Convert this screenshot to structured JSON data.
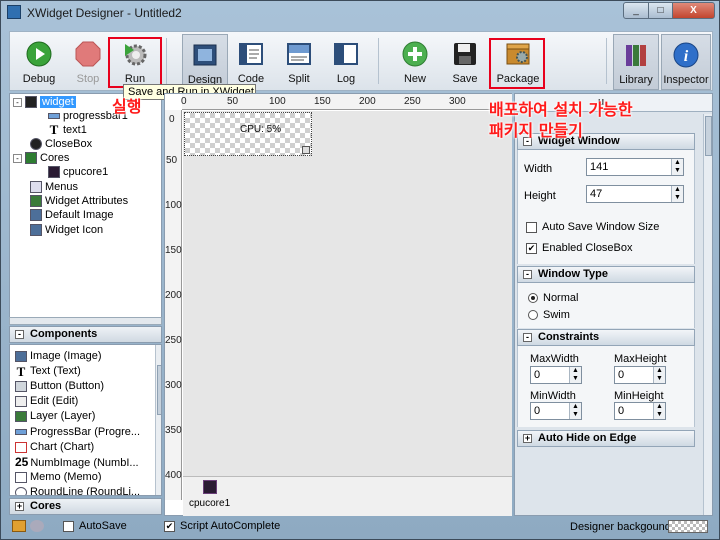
{
  "window": {
    "title": "XWidget Designer - Untitled2",
    "min_label": "_",
    "max_label": "□",
    "close_label": "X"
  },
  "toolbar": {
    "debug": "Debug",
    "stop": "Stop",
    "run": "Run",
    "design": "Design",
    "code": "Code",
    "split": "Split",
    "log": "Log",
    "new": "New",
    "save": "Save",
    "package": "Package",
    "library": "Library",
    "inspector": "Inspector"
  },
  "tooltip": "Save and Run in XWidget",
  "annotations": {
    "run": "실행",
    "package_line1": "배포하여 설치 가능한",
    "package_line2": "패키지 만들기"
  },
  "tree": {
    "items": [
      "widget",
      "progressbar1",
      "text1",
      "CloseBox",
      "Cores",
      "cpucore1",
      "Menus",
      "Widget Attributes",
      "Default Image",
      "Widget Icon"
    ]
  },
  "components": {
    "header": "Components",
    "items": [
      "Image (Image)",
      "Text (Text)",
      "Button (Button)",
      "Edit (Edit)",
      "Layer (Layer)",
      "ProgressBar (Progre...",
      "Chart (Chart)",
      "NumbImage (NumbI...",
      "Memo (Memo)",
      "RoundLine (RoundLi..."
    ],
    "numb_glyph": "25"
  },
  "cores_panel": {
    "header": "Cores"
  },
  "canvas": {
    "ruler_h": [
      "0",
      "50",
      "100",
      "150",
      "200",
      "250",
      "300"
    ],
    "ruler_v": [
      "0",
      "50",
      "100",
      "150",
      "200",
      "250",
      "300",
      "350",
      "400"
    ],
    "widget_text": "CPU: 5%",
    "tray_item": "cpucore1"
  },
  "inspector": {
    "widget_window": "Widget Window",
    "width_label": "Width",
    "width_value": "141",
    "height_label": "Height",
    "height_value": "47",
    "auto_save_size": "Auto Save Window Size",
    "enabled_closebox": "Enabled CloseBox",
    "window_type": "Window Type",
    "normal": "Normal",
    "swim": "Swim",
    "constraints": "Constraints",
    "max_width": "MaxWidth",
    "max_height": "MaxHeight",
    "min_width": "MinWidth",
    "min_height": "MinHeight",
    "max_width_value": "0",
    "max_height_value": "0",
    "min_width_value": "0",
    "min_height_value": "0",
    "auto_hide": "Auto Hide on Edge",
    "top_label": "u"
  },
  "statusbar": {
    "autosave": "AutoSave",
    "script_autocomplete": "Script AutoComplete",
    "designer_bg": "Designer backgound"
  },
  "colors": {
    "accent_highlight": "#e8001c",
    "selection": "#3399ff"
  }
}
